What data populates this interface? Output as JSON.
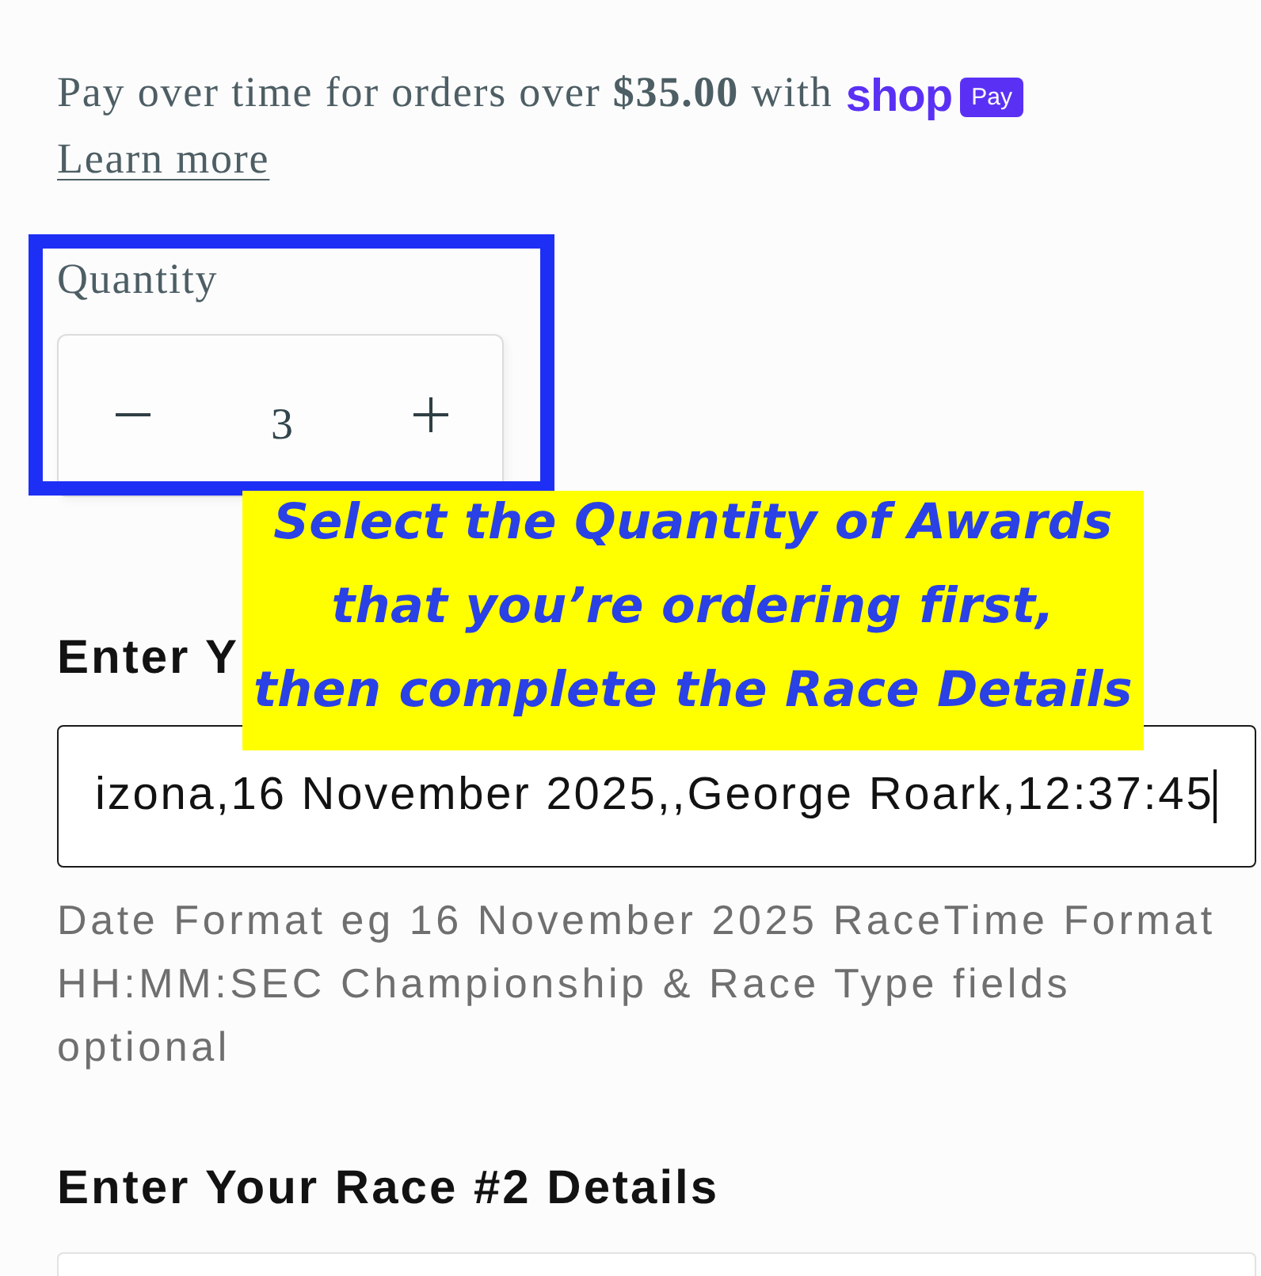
{
  "installments": {
    "message": "Pay over time for orders over **$35.00** with",
    "logo": {
      "wordmark": "shop",
      "badge": "Pay"
    },
    "link": "Learn more"
  },
  "quantity": {
    "label": "Quantity",
    "value": "3",
    "highlighted": true
  },
  "callout": {
    "text": "Select the Quantity of Awards\nthat you’re ordering first,\nthen complete the Race Details"
  },
  "race_fields": [
    {
      "heading": "Enter Y",
      "value": "izona,16 November 2025,,George Roark,12:37:45",
      "focused": true,
      "help": "Date Format eg 16 November 2025 RaceTime Format HH:MM:SEC Championship & Race Type fields optional"
    },
    {
      "heading": "Enter Your Race #2 Details"
    }
  ]
}
